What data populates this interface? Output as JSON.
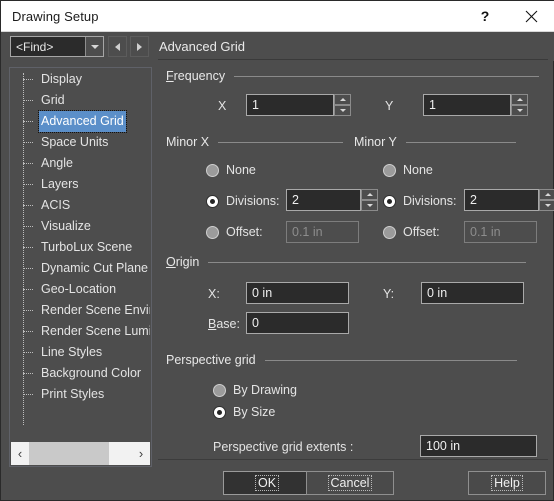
{
  "titlebar": {
    "title": "Drawing Setup",
    "help_icon": "question-mark-icon",
    "close_icon": "close-icon"
  },
  "toolbar": {
    "find_value": "<Find>",
    "dropdown_icon": "chevron-down-icon",
    "prev_icon": "triangle-left-icon",
    "next_icon": "triangle-right-icon"
  },
  "page": {
    "header": "Advanced Grid"
  },
  "tree": {
    "items": [
      {
        "label": "Display",
        "selected": false
      },
      {
        "label": "Grid",
        "selected": false
      },
      {
        "label": "Advanced Grid",
        "selected": true
      },
      {
        "label": "Space Units",
        "selected": false
      },
      {
        "label": "Angle",
        "selected": false
      },
      {
        "label": "Layers",
        "selected": false
      },
      {
        "label": "ACIS",
        "selected": false
      },
      {
        "label": "Visualize",
        "selected": false
      },
      {
        "label": "TurboLux Scene",
        "selected": false
      },
      {
        "label": "Dynamic Cut Plane",
        "selected": false
      },
      {
        "label": "Geo-Location",
        "selected": false
      },
      {
        "label": "Render Scene Environ",
        "selected": false
      },
      {
        "label": "Render Scene Lumina",
        "selected": false
      },
      {
        "label": "Line Styles",
        "selected": false
      },
      {
        "label": "Background Color",
        "selected": false
      },
      {
        "label": "Print Styles",
        "selected": false
      }
    ],
    "scroll_left_icon": "chevron-left-icon",
    "scroll_right_icon": "chevron-right-icon"
  },
  "frequency": {
    "group_label": "Frequency",
    "x_label": "X",
    "x_value": "1",
    "y_label": "Y",
    "y_value": "1"
  },
  "minor_x": {
    "group_label": "Minor X",
    "none_label": "None",
    "divisions_label": "Divisions:",
    "divisions_value": "2",
    "offset_label": "Offset:",
    "offset_placeholder": "0.1 in",
    "selected": "divisions"
  },
  "minor_y": {
    "group_label": "Minor Y",
    "none_label": "None",
    "divisions_label": "Divisions:",
    "divisions_value": "2",
    "offset_label": "Offset:",
    "offset_placeholder": "0.1 in",
    "selected": "divisions"
  },
  "origin": {
    "group_label": "Origin",
    "x_label": "X:",
    "x_value": "0 in",
    "y_label": "Y:",
    "y_value": "0 in",
    "base_label": "Base:",
    "base_value": "0"
  },
  "perspective": {
    "group_label": "Perspective grid",
    "by_drawing_label": "By Drawing",
    "by_size_label": "By Size",
    "selected": "by_size",
    "extents_label": "Perspective grid extents :",
    "extents_value": "100 in"
  },
  "footer": {
    "ok_label": "OK",
    "cancel_label": "Cancel",
    "help_label": "Help"
  },
  "colors": {
    "dialog_bg": "#4d4d4d",
    "field_bg": "#2b2b2b",
    "titlebar_bg": "#ffffff",
    "selection_blue": "#5b8fc9",
    "text": "#e6e6e6"
  }
}
